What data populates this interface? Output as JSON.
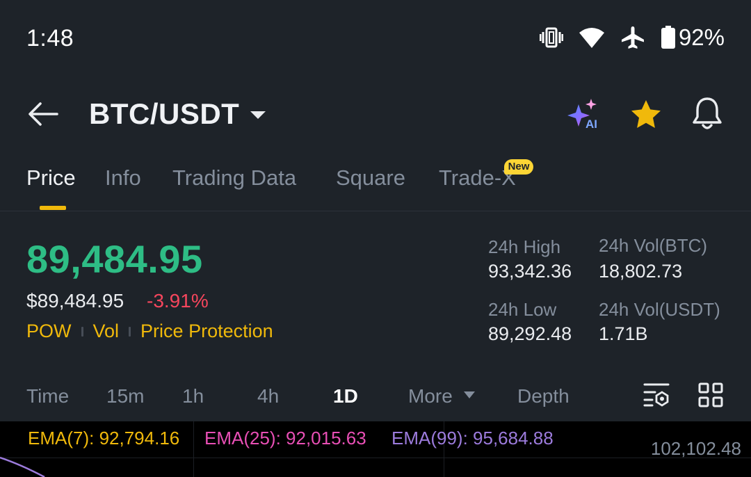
{
  "status_bar": {
    "time": "1:48",
    "battery_percent": "92%",
    "icons": [
      "vibrate-icon",
      "wifi-icon",
      "airplane-mode-icon",
      "battery-icon"
    ]
  },
  "header": {
    "pair": "BTC/USDT",
    "ai_badge": "AI",
    "icons": [
      "back-arrow-icon",
      "caret-down-icon",
      "ai-sparkle-icon",
      "star-icon",
      "bell-icon"
    ],
    "favorite_color": "#f0b90b"
  },
  "tabs": [
    {
      "label": "Price",
      "active": true
    },
    {
      "label": "Info",
      "active": false
    },
    {
      "label": "Trading Data",
      "active": false
    },
    {
      "label": "Square",
      "active": false
    },
    {
      "label": "Trade-X",
      "active": false,
      "badge": "New"
    }
  ],
  "price": {
    "last": "89,484.95",
    "usd": "$89,484.95",
    "change": "-3.91%",
    "up_color": "#2ebd85",
    "down_color": "#f6465d",
    "tags": [
      "POW",
      "Vol",
      "Price Protection"
    ]
  },
  "stats": {
    "high_label": "24h High",
    "high_value": "93,342.36",
    "low_label": "24h Low",
    "low_value": "89,292.48",
    "vol_btc_label": "24h Vol(BTC)",
    "vol_btc_value": "18,802.73",
    "vol_usdt_label": "24h Vol(USDT)",
    "vol_usdt_value": "1.71B"
  },
  "intervals": {
    "items": [
      "Time",
      "15m",
      "1h",
      "4h",
      "1D",
      "More",
      "Depth"
    ],
    "selected": "1D",
    "icons": [
      "chart-settings-icon",
      "grid-layout-icon"
    ]
  },
  "chart": {
    "ema7": "EMA(7): 92,794.16",
    "ema25": "EMA(25): 92,015.63",
    "ema99": "EMA(99): 95,684.88",
    "ema7_color": "#f0b90b",
    "ema25_color": "#e84fb5",
    "ema99_color": "#9c7bdc",
    "axis_top": "102,102.48"
  }
}
